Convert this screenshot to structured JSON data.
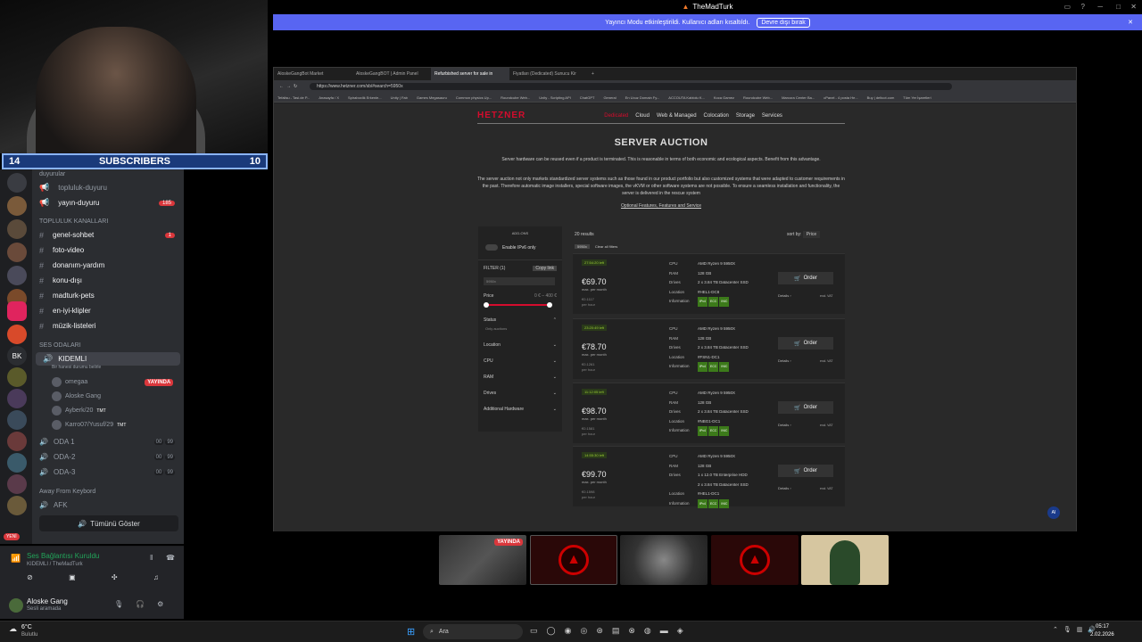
{
  "window": {
    "title": "TheMadTurk"
  },
  "notice": {
    "text": "Yayıncı Modu etkinleştirildi. Kullanıcı adları kısaltıldı.",
    "button": "Devre dışı bırak"
  },
  "overlay": {
    "sub_left": "14",
    "sub_label": "SUBSCRIBERS",
    "sub_right": "10"
  },
  "discord": {
    "cat_announce": "duyurular",
    "ch_topluluk_duyuru": "topluluk-duyuru",
    "ch_yayin_duyuru": "yayın-duyuru",
    "ch_yayin_duyuru_count": "185",
    "cat_community": "TOPLULUK KANALLARI",
    "ch_genel": "genel-sohbet",
    "ch_genel_count": "1",
    "ch_foto": "foto-video",
    "ch_donanim": "donanım-yardım",
    "ch_konu": "konu-dışı",
    "ch_pets": "madturk-pets",
    "ch_klip": "en-iyi-klipler",
    "ch_muzik": "müzik-listeleri",
    "cat_voice": "SES ODALARI",
    "vc_kidemli": "KIDEMLI",
    "vc_kidemli_sub": "Bir hanesi durumu belirle",
    "vu1": "omegaa",
    "vu1_live": "YAYINDA",
    "vu2": "Aloske Gang",
    "vu3": "Ayberk/20",
    "vu3_tag": "TMT",
    "vu4": "Karro07/Yusuf/29",
    "vu4_tag": "TMT",
    "vc_oda1": "ODA 1",
    "vc_oda2": "ODA-2",
    "vc_oda3": "ODA-3",
    "pill_a": "00",
    "pill_b": "99",
    "cat_afk": "Away From Keybord",
    "vc_afk": "AFK",
    "show_all": "Tümünü Göster",
    "voice_connected": "Ses Bağlantısı Kuruldu",
    "voice_channel": "KIDEMLI / TheMadTurk",
    "user_name": "Aloske Gang",
    "user_status": "Sesli aramada",
    "new_badge": "YENİ",
    "guild_bk": "BK"
  },
  "browser": {
    "tabs": [
      "AloskeGangBot Market",
      "AloskeGangBOT | Admin Panel",
      "Refurbished server for sale in",
      "Fiyatları (Dedicated) Sunucu Kir"
    ],
    "url": "https://www.hetzner.com/sb/#search=5950x",
    "bookmarks": [
      "Tefalisu - Tasi.de P...",
      "Anasayfa / X",
      "Spiraboxlik Erkenle...",
      "Unity | Fab",
      "Games Megasauru",
      "Common physics Up...",
      "Roundcube Web...",
      "Unity - Scripting API",
      "ChatGPT",
      "General",
      "En Ucuz Domain Fy...",
      "ACCOUTA Kablolu K...",
      "Koca Gamez",
      "Roundcube Web...",
      "Marcora Center Ba...",
      "cPanel - 4 posta He...",
      "Buy | deltcot.com",
      "Tüm Yer İşaretleri"
    ]
  },
  "hetzner": {
    "logo": "HETZNER",
    "nav": [
      "Dedicated",
      "Cloud",
      "Web & Managed",
      "Colocation",
      "Storage",
      "Services"
    ],
    "title": "SERVER AUCTION",
    "p1": "Server hardware can be reused even if a product is terminated. This is reasonable in terms of both economic and ecological aspects. Benefit from this advantage.",
    "p2": "The server auction not only markets standardized server systems such as those found in our product portfolio but also customized systems that were adapted to customer requirements in the past. Therefore automatic image installers, special software images, the vKVM or other software systems are not possible. To ensure a seamless installation and functionality, the server is delivered in the rescue system",
    "link": "Optional Features, Features and Service",
    "addons": "ADD-ONS",
    "ipv6": "Enable IPv6 only",
    "filter_label": "FILTER (1)",
    "copy_link": "Copy link",
    "search_value": "5950x",
    "price_label": "Price",
    "price_min": "0 €",
    "price_max": "400 €",
    "status_label": "Status",
    "status_sub": "Only auctions",
    "filters": [
      "Location",
      "CPU",
      "RAM",
      "Drives",
      "Additional Hardware"
    ],
    "results_count": "20 results",
    "sort_label": "sort by:",
    "sort_value": "Price",
    "chip": "5950x",
    "clear": "Clear all filters",
    "spec_labels": [
      "CPU",
      "RAM",
      "Drives",
      "",
      "Location",
      "Information"
    ],
    "order": "Order",
    "details": "Details",
    "vat": "excl. VAT",
    "permonth": "max. per month",
    "perhour": "per hour",
    "tags": [
      "IPv4",
      "ECC",
      "INIC"
    ],
    "items": [
      {
        "timer": "27:54:20 left",
        "price": "€69.70",
        "hour": "€0.1117",
        "cpu": "AMD Ryzen 9 5950X",
        "ram": "128 GB",
        "drive1": "2 x 3.84 TB Datacenter SSD",
        "drive2": "",
        "loc": "#HEL1-DC8"
      },
      {
        "timer": "23:20:49 left",
        "price": "€78.70",
        "hour": "€0.1261",
        "cpu": "AMD Ryzen 9 5950X",
        "ram": "128 GB",
        "drive1": "2 x 3.84 TB Datacenter SSD",
        "drive2": "",
        "loc": "#FSN1-DC1"
      },
      {
        "timer": "11:12:05 left",
        "price": "€98.70",
        "hour": "€0.1581",
        "cpu": "AMD Ryzen 9 5950X",
        "ram": "128 GB",
        "drive1": "2 x 3.84 TB Datacenter SSD",
        "drive2": "",
        "loc": "#NBG1-DC1"
      },
      {
        "timer": "14:55:30 left",
        "price": "€99.70",
        "hour": "€0.1598",
        "cpu": "AMD Ryzen 9 5950X",
        "ram": "128 GB",
        "drive1": "1 x 12.0 TB Enterprise HDD",
        "drive2": "2 x 3.84 TB Datacenter SSD",
        "loc": "#HEL1-DC1"
      }
    ]
  },
  "thumbs": {
    "live": "YAYINDA"
  },
  "taskbar": {
    "weather": "6°C",
    "weather_sub": "Bulutlu",
    "search": "Ara",
    "time": "05:17",
    "date": "2.02.2026"
  },
  "colors": {
    "hetzner_red": "#d50c2d",
    "discord_blurple": "#5865f2",
    "live_red": "#da373c"
  }
}
